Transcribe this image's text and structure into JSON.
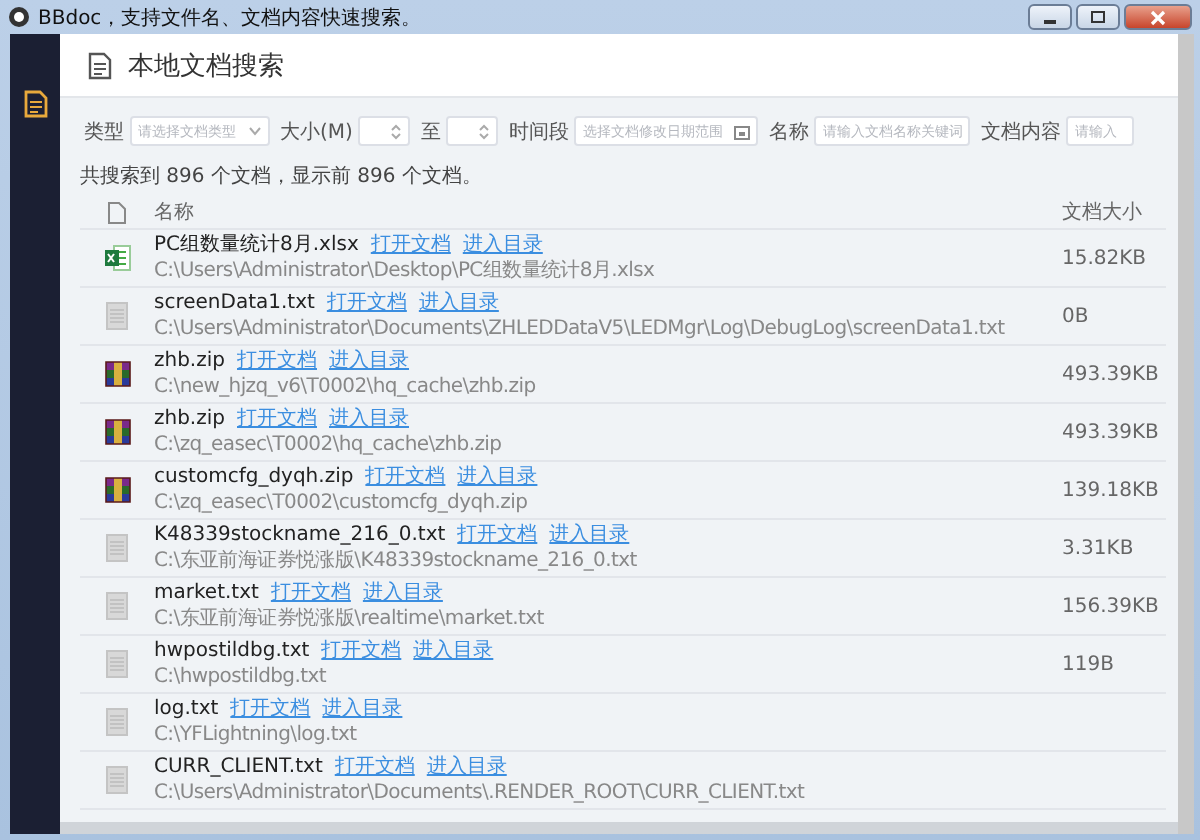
{
  "window": {
    "title": "BBdoc，支持文件名、文档内容快速搜索。"
  },
  "header": {
    "title": "本地文档搜索"
  },
  "filters": [
    {
      "kind": "select",
      "label": "类型",
      "placeholder": "请选择文档类型"
    },
    {
      "kind": "spin",
      "label": "大小(M)"
    },
    {
      "kind": "spin",
      "label": "至"
    },
    {
      "kind": "date",
      "label": "时间段",
      "placeholder": "选择文档修改日期范围"
    },
    {
      "kind": "text",
      "label": "名称",
      "placeholder": "请输入文档名称关键词"
    },
    {
      "kind": "text",
      "label": "文档内容",
      "placeholder": "请输入"
    }
  ],
  "summary": "共搜索到 896 个文档，显示前 896 个文档。",
  "table": {
    "columns": [
      "名称",
      "文档大小"
    ],
    "rows": [
      {
        "kind": "xlsx",
        "name": "PC组数量统计8月.xlsx",
        "links": [
          "打开文档",
          "进入目录"
        ],
        "path": "C:\\Users\\Administrator\\Desktop\\PC组数量统计8月.xlsx",
        "size": "15.82KB"
      },
      {
        "kind": "txt",
        "name": "screenData1.txt",
        "links": [
          "打开文档",
          "进入目录"
        ],
        "path": "C:\\Users\\Administrator\\Documents\\ZHLEDDataV5\\LEDMgr\\Log\\DebugLog\\screenData1.txt",
        "size": "0B"
      },
      {
        "kind": "zip",
        "name": "zhb.zip",
        "links": [
          "打开文档",
          "进入目录"
        ],
        "path": "C:\\new_hjzq_v6\\T0002\\hq_cache\\zhb.zip",
        "size": "493.39KB"
      },
      {
        "kind": "zip",
        "name": "zhb.zip",
        "links": [
          "打开文档",
          "进入目录"
        ],
        "path": "C:\\zq_easec\\T0002\\hq_cache\\zhb.zip",
        "size": "493.39KB"
      },
      {
        "kind": "zip",
        "name": "customcfg_dyqh.zip",
        "links": [
          "打开文档",
          "进入目录"
        ],
        "path": "C:\\zq_easec\\T0002\\customcfg_dyqh.zip",
        "size": "139.18KB"
      },
      {
        "kind": "txt",
        "name": "K48339stockname_216_0.txt",
        "links": [
          "打开文档",
          "进入目录"
        ],
        "path": "C:\\东亚前海证券悦涨版\\K48339stockname_216_0.txt",
        "size": "3.31KB"
      },
      {
        "kind": "txt",
        "name": "market.txt",
        "links": [
          "打开文档",
          "进入目录"
        ],
        "path": "C:\\东亚前海证券悦涨版\\realtime\\market.txt",
        "size": "156.39KB"
      },
      {
        "kind": "txt",
        "name": "hwpostildbg.txt",
        "links": [
          "打开文档",
          "进入目录"
        ],
        "path": "C:\\hwpostildbg.txt",
        "size": "119B"
      },
      {
        "kind": "txt",
        "name": "log.txt",
        "links": [
          "打开文档",
          "进入目录"
        ],
        "path": "C:\\YFLightning\\log.txt"
      },
      {
        "kind": "txt",
        "name": "CURR_CLIENT.txt",
        "links": [
          "打开文档",
          "进入目录"
        ],
        "path": "C:\\Users\\Administrator\\Documents\\.RENDER_ROOT\\CURR_CLIENT.txt"
      }
    ]
  }
}
